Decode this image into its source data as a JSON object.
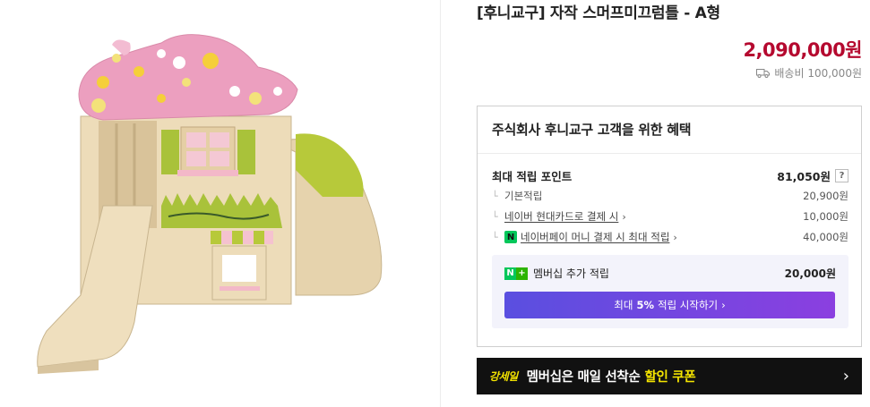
{
  "product": {
    "title": "[후니교구] 자작 스머프미끄럼틀 - A형",
    "price": "2,090,000원",
    "shipping": "배송비 100,000원"
  },
  "benefits": {
    "title": "주식회사 후니교구 고객을 위한 혜택",
    "max_points": {
      "label": "최대 적립 포인트",
      "value": "81,050원",
      "help": "?"
    },
    "rows": [
      {
        "label": "기본적립",
        "value": "20,900원"
      },
      {
        "label": "네이버 현대카드로 결제 시",
        "value": "10,000원"
      },
      {
        "label": "네이버페이 머니 결제 시 최대 적립",
        "value": "40,000원"
      }
    ],
    "membership": {
      "label": "멤버십 추가 적립",
      "value": "20,000원",
      "button_prefix": "최대",
      "button_bold": "5%",
      "button_suffix": "적립 시작하기"
    }
  },
  "banner": {
    "logo": "강세일",
    "text": "멤버십은 매일 선착순",
    "highlight": "할인 쿠폰"
  },
  "colors": {
    "price": "#b5092f",
    "naver_green": "#03c75a",
    "banner_yellow": "#f5e500"
  }
}
